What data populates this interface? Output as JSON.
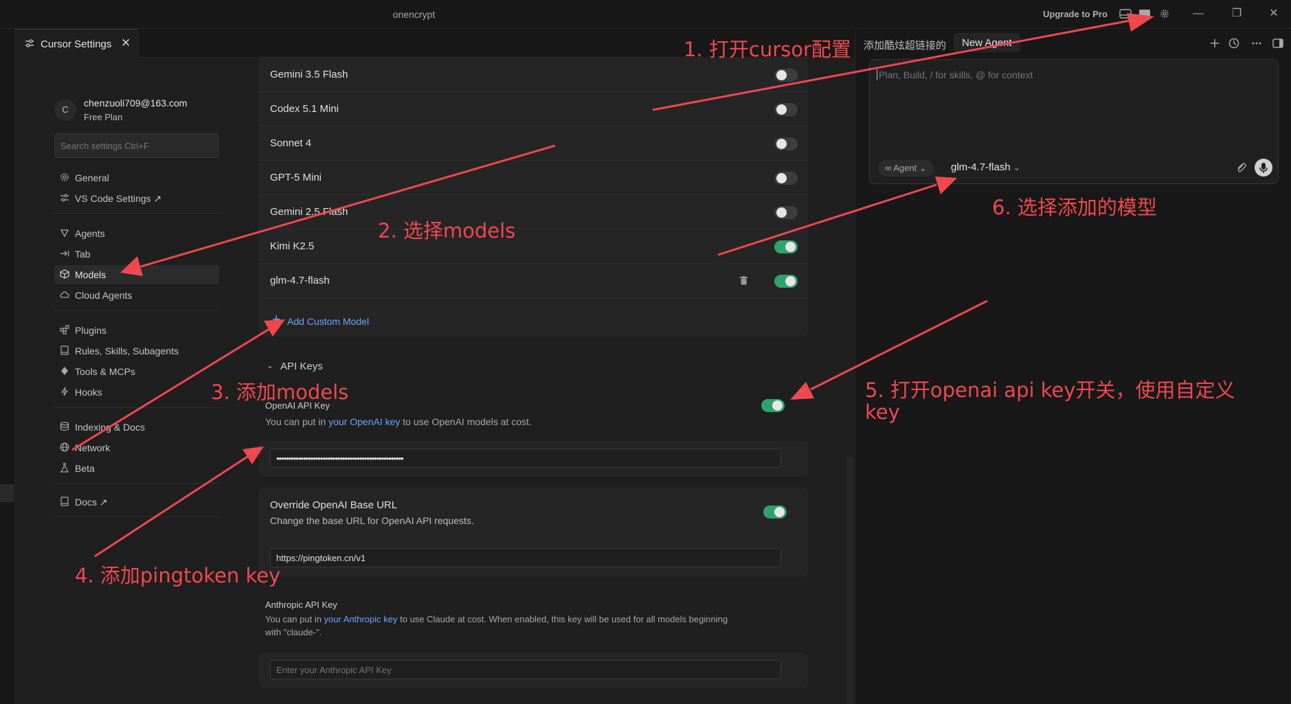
{
  "window": {
    "title": "onencrypt",
    "upgrade_label": "Upgrade to Pro"
  },
  "tab": {
    "label": "Cursor Settings",
    "close": "✕"
  },
  "user": {
    "avatar_initial": "C",
    "email": "chenzuoli709@163.com",
    "plan": "Free Plan"
  },
  "search": {
    "placeholder": "Search settings Ctrl+F"
  },
  "nav": {
    "general": "General",
    "vscode": "VS Code Settings ↗",
    "agents": "Agents",
    "tab": "Tab",
    "models": "Models",
    "cloud_agents": "Cloud Agents",
    "plugins": "Plugins",
    "rules": "Rules, Skills, Subagents",
    "tools": "Tools & MCPs",
    "hooks": "Hooks",
    "indexing": "Indexing & Docs",
    "network": "Network",
    "beta": "Beta",
    "docs": "Docs ↗"
  },
  "models": [
    {
      "name": "Gemini 3.5 Flash",
      "enabled": false
    },
    {
      "name": "Codex 5.1 Mini",
      "enabled": false
    },
    {
      "name": "Sonnet 4",
      "enabled": false
    },
    {
      "name": "GPT-5 Mini",
      "enabled": false
    },
    {
      "name": "Gemini 2.5 Flash",
      "enabled": false
    },
    {
      "name": "Kimi K2.5",
      "enabled": true
    },
    {
      "name": "glm-4.7-flash",
      "enabled": true,
      "custom": true
    }
  ],
  "add_model_label": "Add Custom Model",
  "api_keys": {
    "section_title": "API Keys",
    "openai": {
      "title": "OpenAI API Key",
      "desc_pre": "You can put in ",
      "desc_link": "your OpenAI key",
      "desc_post": " to use OpenAI models at cost.",
      "enabled": true,
      "value": "••••••••••••••••••••••••••••••••••••••••••••••••••••"
    },
    "override": {
      "title": "Override OpenAI Base URL",
      "desc": "Change the base URL for OpenAI API requests.",
      "enabled": true,
      "value": "https://pingtoken.cn/v1"
    },
    "anthropic": {
      "title": "Anthropic API Key",
      "desc_pre": "You can put in ",
      "desc_link": "your Anthropic key",
      "desc_post": " to use Claude at cost. When enabled, this key will be used for all models beginning",
      "desc_line2": "with \"claude-\".",
      "placeholder": "Enter your Anthropic API Key"
    }
  },
  "agent_panel": {
    "tab_title": "添加酷炫超链接的",
    "new_agent": "New Agent",
    "composer_placeholder": "Plan, Build, / for skills, @ for context",
    "mode": "Agent",
    "model": "glm-4.7-flash"
  },
  "annotations": {
    "step1": "1. 打开cursor配置",
    "step2": "2. 选择models",
    "step3": "3. 添加models",
    "step4": "4. 添加pingtoken key",
    "step5_line1": "5. 打开openai api key开关，使用自定义",
    "step5_line2": "key",
    "step6": "6. 选择添加的模型",
    "color": "#f0484f"
  },
  "colors": {
    "accent": "#6fa3ff",
    "toggle_on": "#2ea36a",
    "annotation": "#f0484f"
  }
}
